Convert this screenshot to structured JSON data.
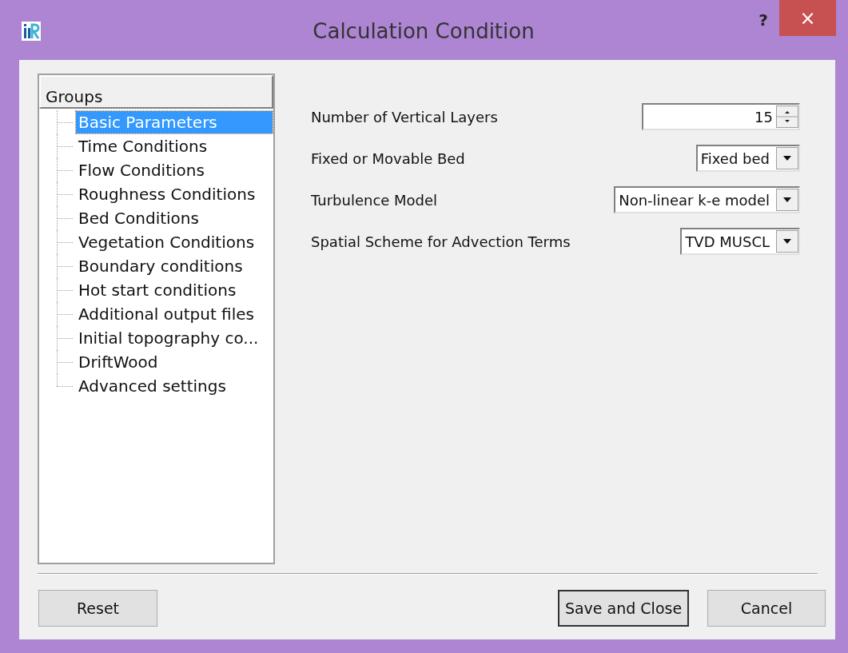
{
  "window": {
    "title": "Calculation Condition",
    "help": "?",
    "close": "×"
  },
  "groups": {
    "header": "Groups",
    "items": [
      {
        "label": "Basic Parameters",
        "selected": true
      },
      {
        "label": "Time Conditions",
        "selected": false
      },
      {
        "label": "Flow Conditions",
        "selected": false
      },
      {
        "label": "Roughness Conditions",
        "selected": false
      },
      {
        "label": "Bed Conditions",
        "selected": false
      },
      {
        "label": "Vegetation Conditions",
        "selected": false
      },
      {
        "label": "Boundary conditions",
        "selected": false
      },
      {
        "label": "Hot start conditions",
        "selected": false
      },
      {
        "label": "Additional output files",
        "selected": false
      },
      {
        "label": "Initial topography co...",
        "selected": false
      },
      {
        "label": "DriftWood",
        "selected": false
      },
      {
        "label": "Advanced settings",
        "selected": false
      }
    ]
  },
  "fields": [
    {
      "kind": "spinbox",
      "label": "Number of Vertical Layers",
      "value": "15"
    },
    {
      "kind": "combo",
      "label": "Fixed or Movable Bed",
      "value": "Fixed bed"
    },
    {
      "kind": "combo",
      "label": "Turbulence Model",
      "value": "Non-linear k-e model"
    },
    {
      "kind": "combo",
      "label": "Spatial Scheme for Advection Terms",
      "value": "TVD MUSCL"
    }
  ],
  "buttons": [
    {
      "label": "Reset",
      "kind": "left",
      "default": false
    },
    {
      "label": "Save and Close",
      "kind": "right",
      "default": true
    },
    {
      "label": "Cancel",
      "kind": "right",
      "default": false
    }
  ]
}
